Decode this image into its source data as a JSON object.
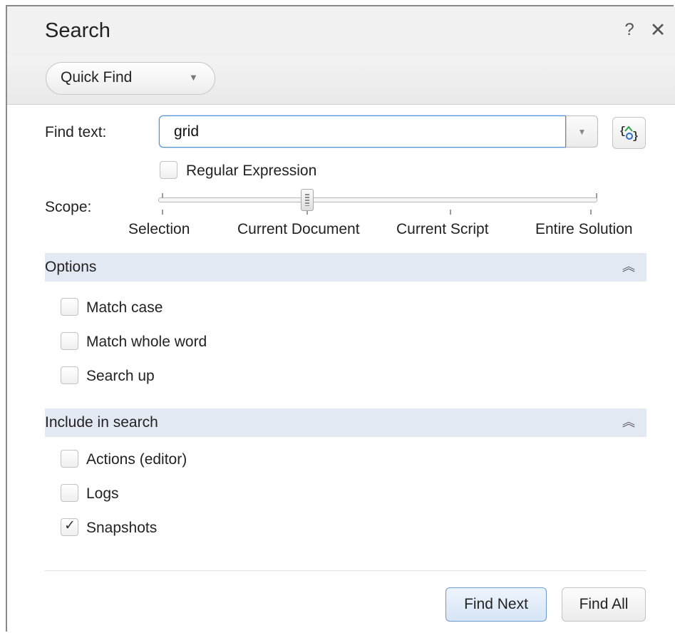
{
  "dialog": {
    "title": "Search",
    "help_icon": "?",
    "close_icon": "✕"
  },
  "toolbar": {
    "mode_selected": "Quick Find"
  },
  "find": {
    "label": "Find text:",
    "value": "grid",
    "regex_label": "Regular Expression",
    "regex_checked": false
  },
  "scope": {
    "label": "Scope:",
    "options": [
      "Selection",
      "Current Document",
      "Current Script",
      "Entire Solution"
    ],
    "selected": "Current Document"
  },
  "options_section": {
    "title": "Options",
    "items": [
      {
        "label": "Match case",
        "checked": false
      },
      {
        "label": "Match whole word",
        "checked": false
      },
      {
        "label": "Search up",
        "checked": false
      }
    ]
  },
  "include_section": {
    "title": "Include in search",
    "items": [
      {
        "label": "Actions (editor)",
        "checked": false
      },
      {
        "label": "Logs",
        "checked": false
      },
      {
        "label": "Snapshots",
        "checked": true
      }
    ]
  },
  "buttons": {
    "find_next": "Find Next",
    "find_all": "Find All"
  },
  "colors": {
    "accent": "#4a8ed6",
    "section_header": "#e3e9f3",
    "regex_icon_green": "#2fa34a",
    "regex_icon_blue": "#2f6fd0"
  }
}
